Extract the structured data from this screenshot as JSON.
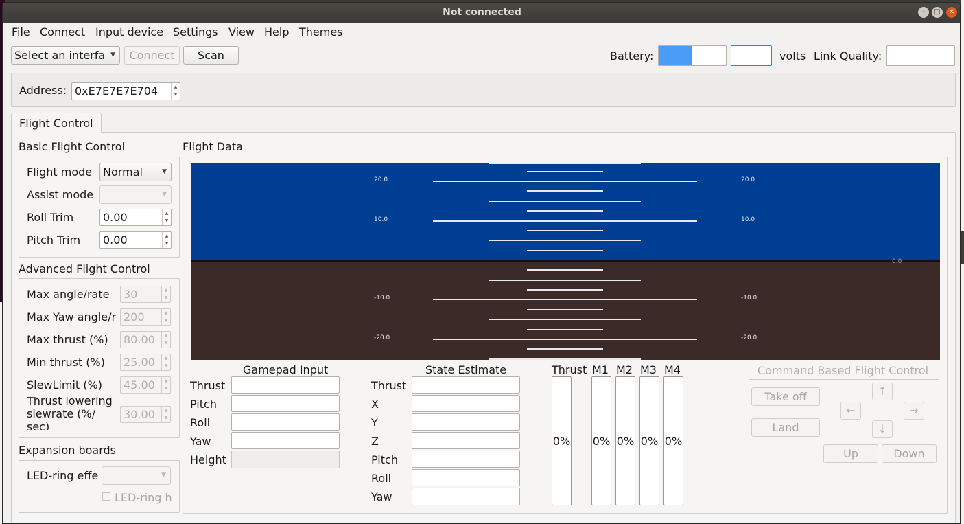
{
  "window": {
    "title": "Not connected"
  },
  "menubar": [
    "File",
    "Connect",
    "Input device",
    "Settings",
    "View",
    "Help",
    "Themes"
  ],
  "toolbar": {
    "interface_select": "Select an interfa",
    "connect_button": "Connect",
    "scan_button": "Scan",
    "battery_label": "Battery:",
    "battery_level": 0.5,
    "volts_label": "volts",
    "link_quality_label": "Link Quality:"
  },
  "address": {
    "label": "Address:",
    "value": "0xE7E7E7E704"
  },
  "tabs": [
    "Flight Control"
  ],
  "basic_flight_control": {
    "title": "Basic Flight Control",
    "flight_mode_label": "Flight mode",
    "flight_mode_value": "Normal",
    "assist_mode_label": "Assist mode",
    "assist_mode_value": "",
    "roll_trim_label": "Roll Trim",
    "roll_trim_value": "0.00",
    "pitch_trim_label": "Pitch Trim",
    "pitch_trim_value": "0.00"
  },
  "advanced_flight_control": {
    "title": "Advanced Flight Control",
    "max_angle_label": "Max angle/rate",
    "max_angle_value": "30",
    "max_yaw_label": "Max Yaw angle/r",
    "max_yaw_value": "200",
    "max_thrust_label": "Max thrust (%)",
    "max_thrust_value": "80.00",
    "min_thrust_label": "Min thrust (%)",
    "min_thrust_value": "25.00",
    "slew_limit_label": "SlewLimit (%)",
    "slew_limit_value": "45.00",
    "thrust_lowering_label": "Thrust lowering slewrate (%/ sec)",
    "thrust_lowering_value": "30.00"
  },
  "expansion_boards": {
    "title": "Expansion boards",
    "led_ring_effect_label": "LED-ring effe",
    "led_ring_effect_value": "",
    "led_ring_headlight_label": "LED-ring h"
  },
  "flight_data": {
    "title": "Flight Data",
    "horizon_labels": {
      "p20": "20.0",
      "p10": "10.0",
      "zero": "0.0",
      "m10": "-10.0",
      "m20": "-20.0"
    }
  },
  "gamepad_input": {
    "title": "Gamepad Input",
    "labels": [
      "Thrust",
      "Pitch",
      "Roll",
      "Yaw",
      "Height"
    ]
  },
  "state_estimate": {
    "title": "State Estimate",
    "labels": [
      "Thrust",
      "X",
      "Y",
      "Z",
      "Pitch",
      "Roll",
      "Yaw"
    ]
  },
  "motors": {
    "labels": [
      "Thrust",
      "M1",
      "M2",
      "M3",
      "M4"
    ],
    "values": [
      "0%",
      "0%",
      "0%",
      "0%",
      "0%"
    ]
  },
  "command_based": {
    "title": "Command Based Flight Control",
    "take_off": "Take off",
    "land": "Land",
    "up_arrow": "↑",
    "left_arrow": "←",
    "right_arrow": "→",
    "down_arrow": "↓",
    "up": "Up",
    "down": "Down"
  },
  "colors": {
    "sky": "#003e94",
    "ground": "#3b2a27",
    "battery_fill": "#4a9cf5",
    "close_button": "#e9541f"
  }
}
